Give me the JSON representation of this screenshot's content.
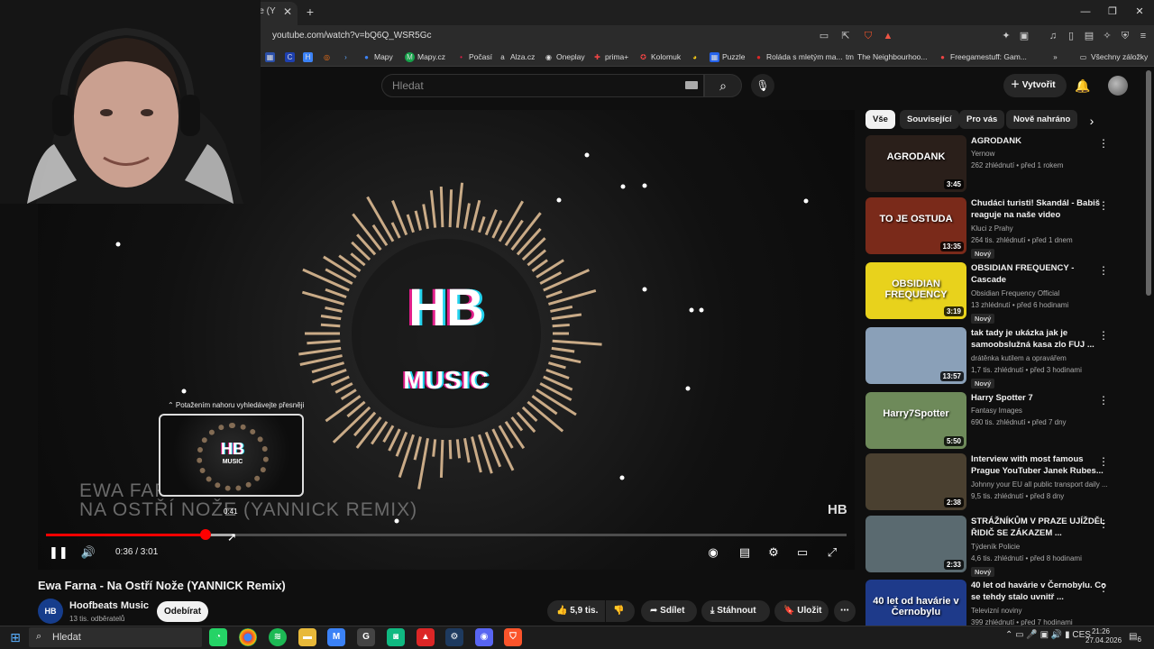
{
  "browser": {
    "tab_title": "re (Y",
    "url": "youtube.com/watch?v=bQ6Q_WSR5Gc",
    "bookmarks": [
      {
        "label": "Mapy",
        "color": "#3b82f6"
      },
      {
        "label": "Mapy.cz",
        "color": "#16a34a"
      },
      {
        "label": "Počasí",
        "color": "#e11d48"
      },
      {
        "label": "Alza.cz",
        "color": "#ffffff"
      },
      {
        "label": "Oneplay",
        "color": "#ffffff"
      },
      {
        "label": "prima+",
        "color": "#ef4444"
      },
      {
        "label": "Kolomuk",
        "color": "#ef4444"
      },
      {
        "label": "Puzzle",
        "color": "#2563eb"
      },
      {
        "label": "Roláda s mletým ma...",
        "color": "#dc2626"
      },
      {
        "label": "The Neighbourhoo...",
        "color": "#ffffff"
      },
      {
        "label": "Freegamestuff: Gam...",
        "color": "#ef4444"
      }
    ],
    "all_bookmarks": "Všechny záložky"
  },
  "youtube": {
    "search_placeholder": "Hledat",
    "create_label": "Vytvořit"
  },
  "player": {
    "overlay_line1": "EWA FAR",
    "overlay_line2": "NA OSTŘÍ NOŽE (YANNICK REMIX)",
    "logo_top": "HB",
    "logo_bottom": "MUSIC",
    "watermark": "HB",
    "seek_hint": "⌃ Potažením nahoru vyhledávejte přesněji",
    "hover_time": "0:41",
    "current_time": "0:36 / 3:01",
    "progress": 0.199
  },
  "video": {
    "title": "Ewa Farna - Na Ostří Nože (YANNICK Remix)",
    "channel": "Hoofbeats Music",
    "channel_avatar_text": "HB",
    "subscribers": "13 tis. odběratelů",
    "subscribe_label": "Odebírat",
    "likes": "5,9 tis.",
    "share_label": "Sdílet",
    "download_label": "Stáhnout",
    "save_label": "Uložit"
  },
  "chips": [
    "Vše",
    "Související",
    "Pro vás",
    "Nově nahráno"
  ],
  "recommendations": [
    {
      "title": "AGRODANK",
      "channel": "Yernow",
      "meta": "262 zhlédnutí • před 1 rokem",
      "duration": "3:45",
      "new": "",
      "thumb_text": "AGRODANK",
      "thumb_bg": "#2a1f1a"
    },
    {
      "title": "Chudáci turisti! Skandál - Babiš reaguje na naše video",
      "channel": "Kluci z Prahy",
      "meta": "264 tis. zhlédnutí • před 1 dnem",
      "duration": "13:35",
      "new": "Nový",
      "thumb_text": "TO JE OSTUDA",
      "thumb_bg": "#7a2a1a"
    },
    {
      "title": "OBSIDIAN FREQUENCY - Cascade",
      "channel": "Obsidian Frequency Official",
      "meta": "13 zhlédnutí • před 6 hodinami",
      "duration": "3:19",
      "new": "Nový",
      "thumb_text": "OBSIDIAN FREQUENCY",
      "thumb_bg": "#e8d21c"
    },
    {
      "title": "tak tady je ukázka jak je samoobslužná kasa zlo FUJ ...",
      "channel": "drátěnka kutilem a opravářem",
      "meta": "1,7 tis. zhlédnutí • před 3 hodinami",
      "duration": "13:57",
      "new": "Nový",
      "thumb_text": "",
      "thumb_bg": "#8aa0b8"
    },
    {
      "title": "Harry Spotter 7",
      "channel": "Fantasy Images",
      "meta": "690 tis. zhlédnutí • před 7 dny",
      "duration": "5:50",
      "new": "",
      "thumb_text": "Harry7Spotter",
      "thumb_bg": "#6e8a5a"
    },
    {
      "title": "Interview with most famous Prague YouTuber Janek Rubes...",
      "channel": "Johnny your EU all public transport daily ...",
      "meta": "9,5 tis. zhlédnutí • před 8 dny",
      "duration": "2:38",
      "new": "",
      "thumb_text": "",
      "thumb_bg": "#4a4030"
    },
    {
      "title": "STRÁŽNÍKŮM V PRAZE UJÍŽDĚL ŘIDIČ SE ZÁKAZEM ...",
      "channel": "Týdeník Policie",
      "meta": "4,6 tis. zhlédnutí • před 8 hodinami",
      "duration": "2:33",
      "new": "Nový",
      "thumb_text": "",
      "thumb_bg": "#5a6a70"
    },
    {
      "title": "40 let od havárie v Černobylu. Co se tehdy stalo uvnitř ...",
      "channel": "Televizní noviny",
      "meta": "399 zhlédnutí • před 7 hodinami",
      "duration": "",
      "new": "",
      "thumb_text": "40 let od havárie v Černobylu",
      "thumb_bg": "#1e3a8a"
    }
  ],
  "taskbar": {
    "search_placeholder": "Hledat",
    "language": "CES",
    "time": "21:26",
    "date": "27.04.2026",
    "notification_count": "6"
  },
  "colors": {
    "accent_red": "#ff0000",
    "bg": "#0f0f0f",
    "chip": "#272727"
  }
}
